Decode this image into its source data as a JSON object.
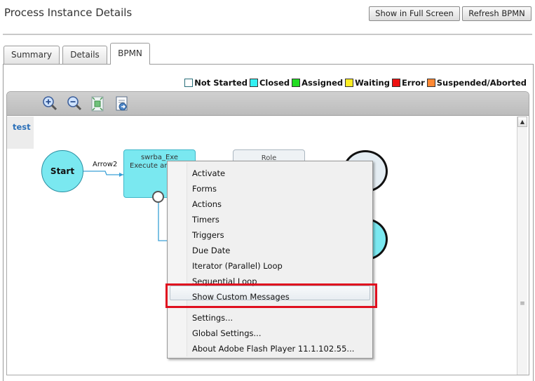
{
  "header": {
    "title": "Process Instance Details",
    "fullscreen_label": "Show in Full Screen",
    "refresh_label": "Refresh BPMN"
  },
  "tabs": [
    {
      "label": "Summary",
      "active": false
    },
    {
      "label": "Details",
      "active": false
    },
    {
      "label": "BPMN",
      "active": true
    }
  ],
  "legend": [
    {
      "label": "Not Started",
      "color": "#ffffff"
    },
    {
      "label": "Closed",
      "color": "#33f0f2"
    },
    {
      "label": "Assigned",
      "color": "#22dd22"
    },
    {
      "label": "Waiting",
      "color": "#ffee22"
    },
    {
      "label": "Error",
      "color": "#ee1111"
    },
    {
      "label": "Suspended/Aborted",
      "color": "#ff8833"
    }
  ],
  "toolbar": {
    "icons": [
      "zoom-in-icon",
      "zoom-out-icon",
      "fit-to-screen-icon",
      "export-icon"
    ]
  },
  "diagram": {
    "lane_label": "test",
    "start_label": "Start",
    "arrow_label": "Arrow2",
    "task_title": "swrba_Exe",
    "task_subtitle": "Execute an",
    "role_label": "Role"
  },
  "context_menu": {
    "items": [
      "Activate",
      "Forms",
      "Actions",
      "Timers",
      "Triggers",
      "Due Date",
      "Iterator (Parallel) Loop",
      "Sequential Loop",
      "Show Custom Messages"
    ],
    "highlighted": "Show Custom Messages",
    "settings_items": [
      "Settings...",
      "Global Settings...",
      "About Adobe Flash Player 11.1.102.55..."
    ]
  },
  "colors": {
    "node_fill": "#7ae8f0",
    "highlight_box": "#e0101f",
    "lane_label": "#2a6fb8"
  }
}
